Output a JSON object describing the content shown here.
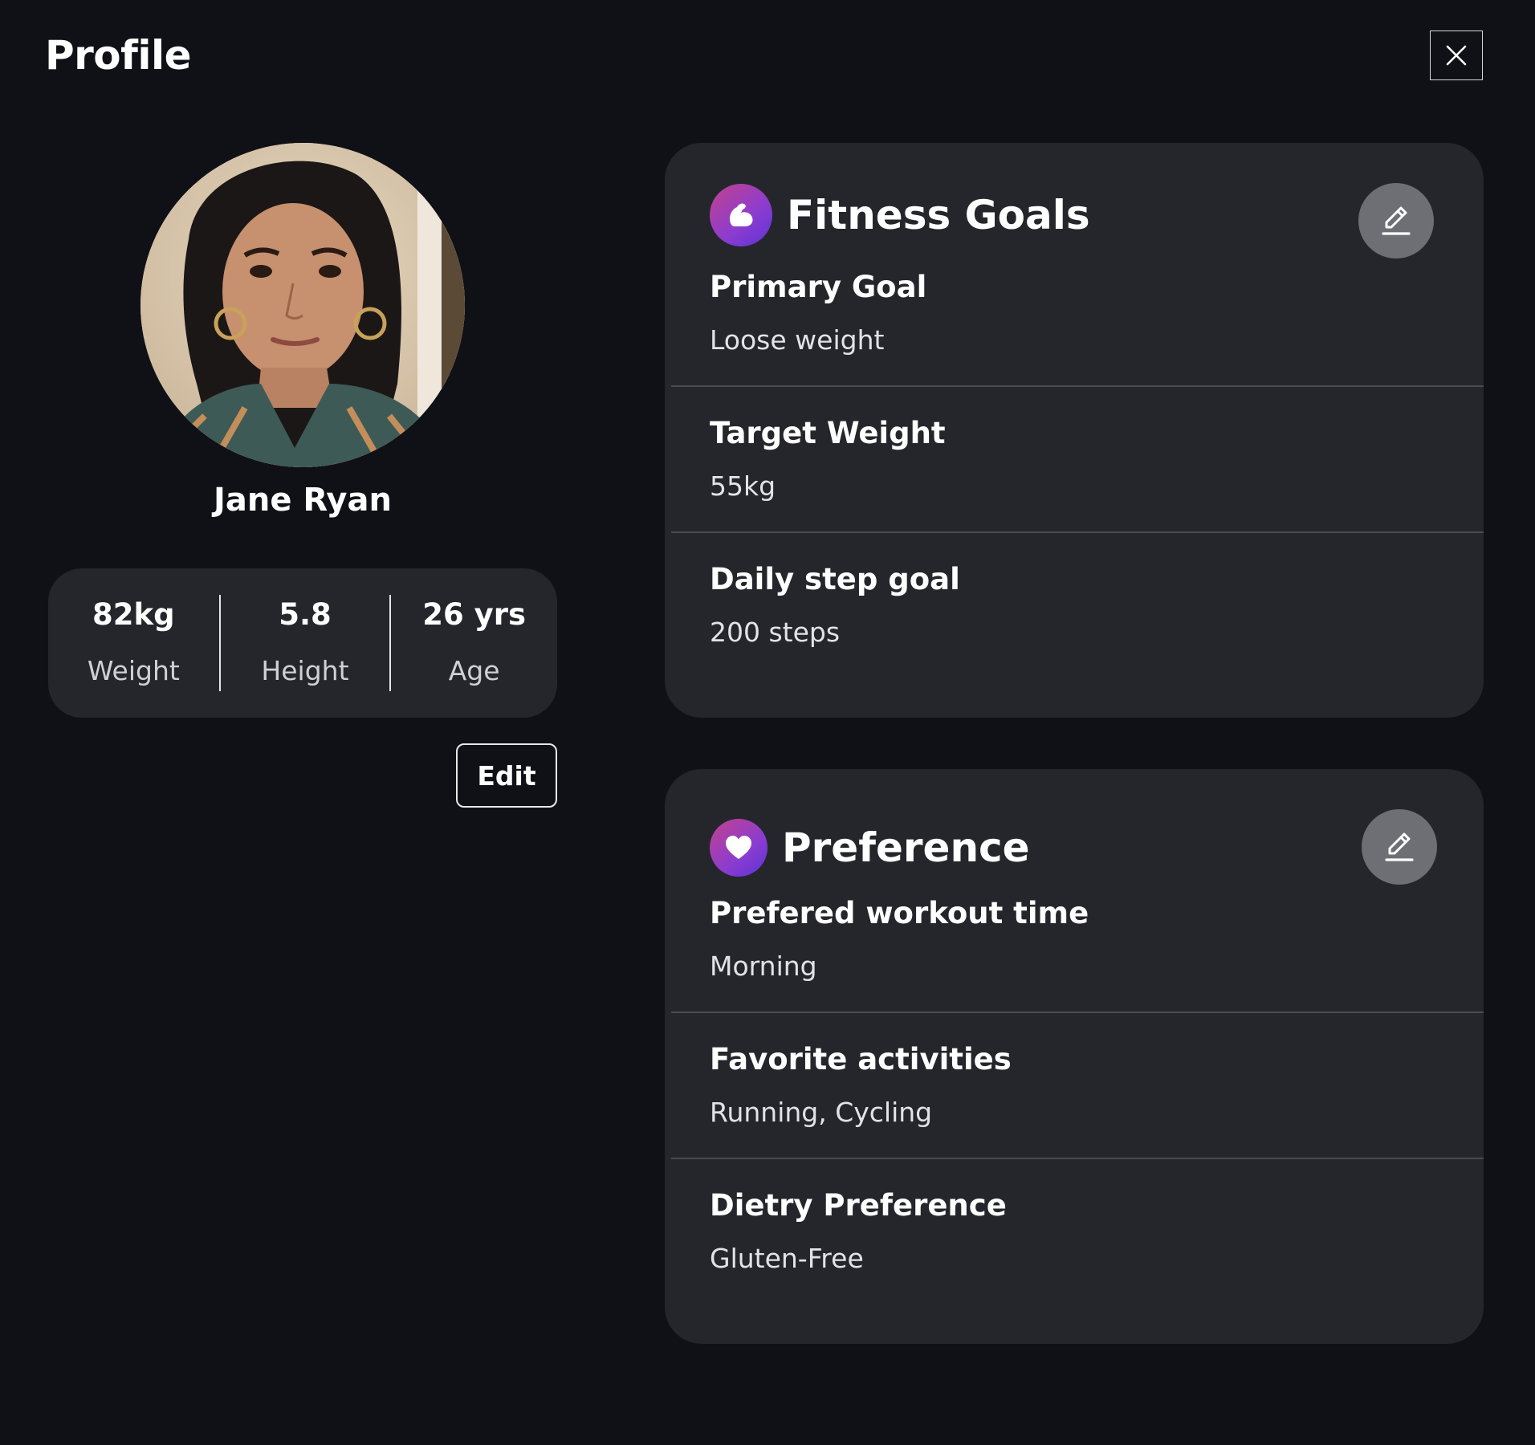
{
  "page": {
    "title": "Profile"
  },
  "profile": {
    "name": "Jane Ryan",
    "avatar_alt": "Profile photo of Jane Ryan",
    "stats": [
      {
        "value": "82kg",
        "label": "Weight"
      },
      {
        "value": "5.8",
        "label": "Height"
      },
      {
        "value": "26 yrs",
        "label": "Age"
      }
    ],
    "edit_label": "Edit"
  },
  "fitness_goals": {
    "title": "Fitness Goals",
    "icon": "flexed-bicep-icon",
    "fields": [
      {
        "label": "Primary Goal",
        "value": "Loose weight"
      },
      {
        "label": "Target Weight",
        "value": "55kg"
      },
      {
        "label": "Daily step goal",
        "value": "200 steps"
      }
    ]
  },
  "preference": {
    "title": "Preference",
    "icon": "heart-icon",
    "fields": [
      {
        "label": "Prefered workout time",
        "value": "Morning"
      },
      {
        "label": "Favorite activities",
        "value": "Running, Cycling"
      },
      {
        "label": "Dietry Preference",
        "value": "Gluten-Free"
      }
    ]
  },
  "colors": {
    "background": "#101117",
    "card": "#25262b",
    "edit_circle": "#6e6f75",
    "badge_gradient_start": "#c2438c",
    "badge_gradient_end": "#5b33d6"
  }
}
